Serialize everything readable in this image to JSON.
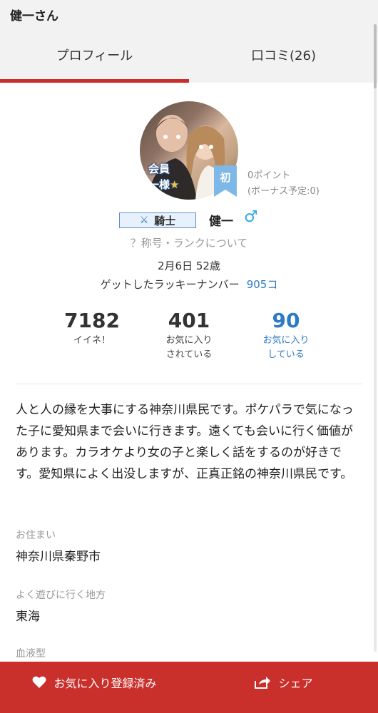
{
  "header": {
    "title": "健一さん"
  },
  "tabs": [
    {
      "label": "プロフィール",
      "active": true
    },
    {
      "label": "口コミ(26)",
      "active": false
    }
  ],
  "avatar": {
    "badge_line1": "会員",
    "badge_line2": "一様"
  },
  "rank": {
    "label": "初"
  },
  "points": {
    "current": "0ポイント",
    "bonus": "(ボーナス予定:0)"
  },
  "profile": {
    "title_badge": "騎士",
    "name": "健一",
    "gender_symbol": "♂",
    "rank_info_link": "？称号・ランクについて",
    "birth_age": "2月6日 52歳",
    "lucky_label": "ゲットしたラッキーナンバー",
    "lucky_value": "905コ"
  },
  "stats": [
    {
      "value": "7182",
      "label_line1": "イイネ！",
      "label_line2": ""
    },
    {
      "value": "401",
      "label_line1": "お気に入り",
      "label_line2": "されている"
    },
    {
      "value": "90",
      "label_line1": "お気に入り",
      "label_line2": "している"
    }
  ],
  "bio": "人と人の縁を大事にする神奈川県民です。ポケパラで気になった子に愛知県まで会いに行きます。遠くても会いに行く価値があります。カラオケより女の子と楽しく話をするのが好きです。愛知県によく出没しますが、正真正銘の神奈川県民です。",
  "fields": {
    "residence_label": "お住まい",
    "residence_value": "神奈川県秦野市",
    "area_label": "よく遊びに行く地方",
    "area_value": "東海",
    "blood_label": "血液型"
  },
  "bottom_bar": {
    "favorite_label": "お気に入り登録済み",
    "share_label": "シェア"
  },
  "colors": {
    "accent_red": "#c9302c",
    "link_blue": "#2d7bc4",
    "male_blue": "#2fa7e0"
  }
}
